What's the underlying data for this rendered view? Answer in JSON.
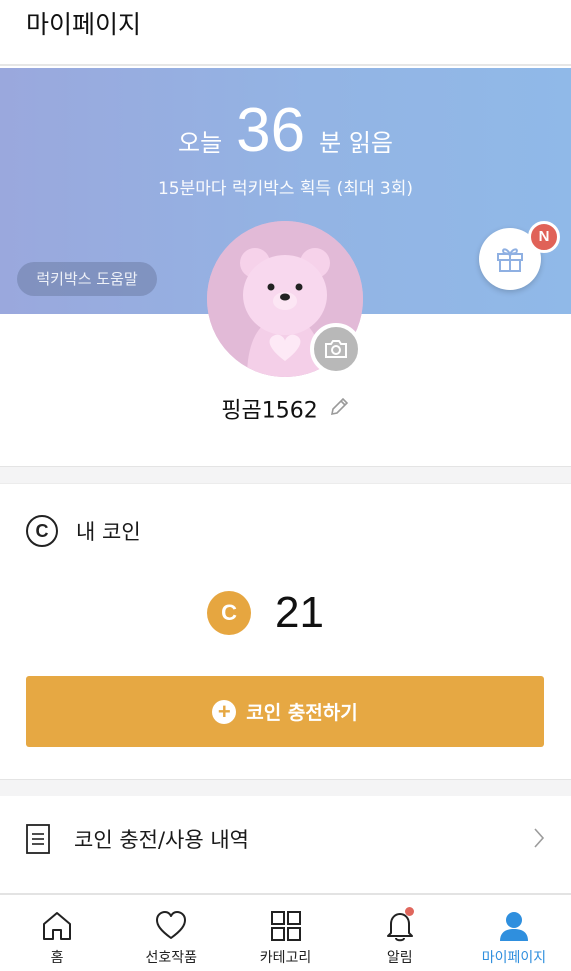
{
  "header": {
    "title": "마이페이지"
  },
  "banner": {
    "prefix": "오늘",
    "minutes": "36",
    "suffix": "분 읽음",
    "subtitle": "15분마다 럭키박스 획득 (최대 3회)",
    "help_label": "럭키박스 도움말",
    "gift_badge": "N",
    "background_colors": [
      "#9aa8dd",
      "#90b9e8"
    ]
  },
  "profile": {
    "nickname": "핑곰1562",
    "avatar_icon": "bear-avatar",
    "camera_icon": "camera-icon",
    "edit_icon": "pencil-icon"
  },
  "coins": {
    "heading": "내 코인",
    "balance": "21",
    "charge_label": "코인 충전하기",
    "accent": "#e6a843"
  },
  "menu": {
    "history_label": "코인 충전/사용 내역"
  },
  "tabs": [
    {
      "label": "홈",
      "icon": "home-icon"
    },
    {
      "label": "선호작품",
      "icon": "heart-icon"
    },
    {
      "label": "카테고리",
      "icon": "grid-icon"
    },
    {
      "label": "알림",
      "icon": "bell-icon"
    },
    {
      "label": "마이페이지",
      "icon": "person-icon",
      "active": true,
      "color": "#2f8fde"
    }
  ]
}
